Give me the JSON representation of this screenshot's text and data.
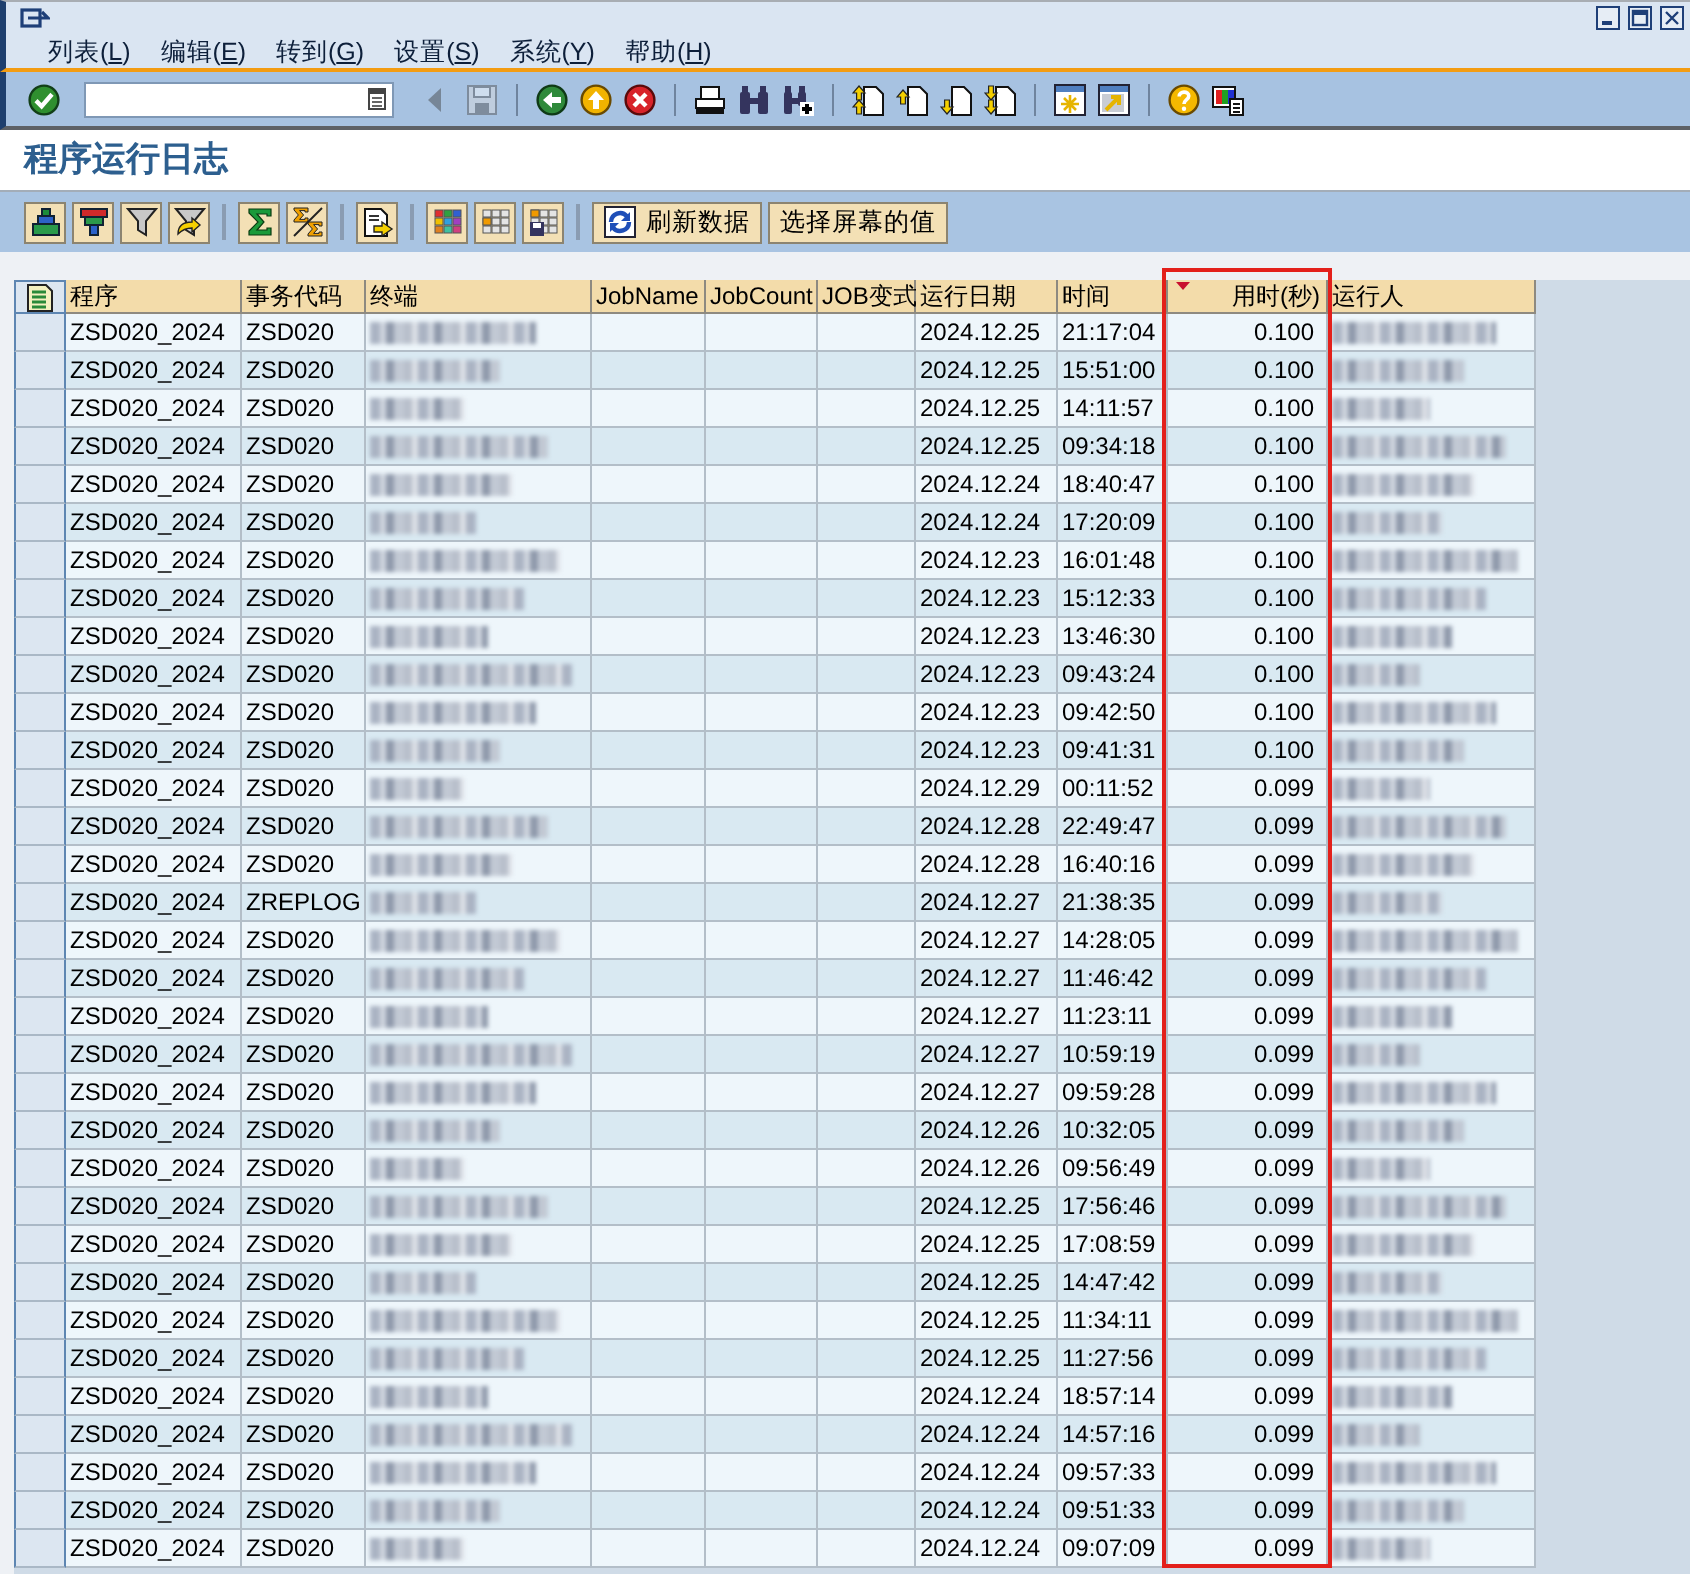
{
  "menu": [
    {
      "prefix": "列表(",
      "accel": "L",
      "suffix": ")"
    },
    {
      "prefix": "编辑(",
      "accel": "E",
      "suffix": ")"
    },
    {
      "prefix": "转到(",
      "accel": "G",
      "suffix": ")"
    },
    {
      "prefix": "设置(",
      "accel": "S",
      "suffix": ")"
    },
    {
      "prefix": "系统(",
      "accel": "Y",
      "suffix": ")"
    },
    {
      "prefix": "帮助(",
      "accel": "H",
      "suffix": ")"
    }
  ],
  "system_toolbar": [
    {
      "kind": "button",
      "disabled": false
    },
    {
      "kind": "field"
    },
    {
      "kind": "button",
      "disabled": true
    },
    {
      "kind": "button",
      "disabled": true
    },
    {
      "kind": "separator"
    },
    {
      "kind": "button",
      "disabled": false
    },
    {
      "kind": "button",
      "disabled": false
    },
    {
      "kind": "button",
      "disabled": false
    },
    {
      "kind": "separator"
    },
    {
      "kind": "button",
      "disabled": false
    },
    {
      "kind": "button",
      "disabled": false
    },
    {
      "kind": "button",
      "disabled": false
    },
    {
      "kind": "separator"
    },
    {
      "kind": "button",
      "disabled": false
    },
    {
      "kind": "button",
      "disabled": false
    },
    {
      "kind": "button",
      "disabled": false
    },
    {
      "kind": "button",
      "disabled": false
    },
    {
      "kind": "separator"
    },
    {
      "kind": "button",
      "disabled": false
    },
    {
      "kind": "button",
      "disabled": false
    },
    {
      "kind": "separator"
    },
    {
      "kind": "button",
      "disabled": false
    },
    {
      "kind": "button",
      "disabled": false
    }
  ],
  "screen_title": "程序运行日志",
  "app_toolbar": [
    {
      "kind": "button"
    },
    {
      "kind": "button"
    },
    {
      "kind": "button"
    },
    {
      "kind": "button"
    },
    {
      "kind": "separator"
    },
    {
      "kind": "button"
    },
    {
      "kind": "button"
    },
    {
      "kind": "separator"
    },
    {
      "kind": "button"
    },
    {
      "kind": "separator"
    },
    {
      "kind": "button"
    },
    {
      "kind": "button"
    },
    {
      "kind": "button"
    },
    {
      "kind": "separator"
    },
    {
      "kind": "labeled_button",
      "label": "刷新数据",
      "has_icon": true
    },
    {
      "kind": "labeled_button",
      "label": "选择屏幕的值"
    }
  ],
  "table": {
    "columns": [
      {
        "label": "程序",
        "kind": "text",
        "sorted": false,
        "highlighted": false
      },
      {
        "label": "事务代码",
        "kind": "text",
        "sorted": false,
        "highlighted": false
      },
      {
        "label": "终端",
        "kind": "blurred",
        "sorted": false,
        "highlighted": false
      },
      {
        "label": "JobName",
        "kind": "text",
        "sorted": false,
        "highlighted": false
      },
      {
        "label": "JobCount",
        "kind": "text",
        "sorted": false,
        "highlighted": false
      },
      {
        "label": "JOB变式",
        "kind": "text",
        "sorted": false,
        "highlighted": false
      },
      {
        "label": "运行日期",
        "kind": "text",
        "sorted": false,
        "highlighted": false
      },
      {
        "label": "时间",
        "kind": "text",
        "sorted": false,
        "highlighted": false
      },
      {
        "label": "用时(秒)",
        "kind": "number",
        "sorted": true,
        "highlighted": true
      },
      {
        "label": "运行人",
        "kind": "blurred",
        "sorted": false,
        "highlighted": false
      }
    ],
    "rows": [
      {
        "selected": false,
        "cells": [
          "ZSD020_2024",
          "ZSD020",
          null,
          null,
          null,
          null,
          "2024.12.25",
          "21:17:04",
          "0.100",
          null
        ]
      },
      {
        "selected": false,
        "cells": [
          "ZSD020_2024",
          "ZSD020",
          null,
          null,
          null,
          null,
          "2024.12.25",
          "15:51:00",
          "0.100",
          null
        ]
      },
      {
        "selected": false,
        "cells": [
          "ZSD020_2024",
          "ZSD020",
          null,
          null,
          null,
          null,
          "2024.12.25",
          "14:11:57",
          "0.100",
          null
        ]
      },
      {
        "selected": false,
        "cells": [
          "ZSD020_2024",
          "ZSD020",
          null,
          null,
          null,
          null,
          "2024.12.25",
          "09:34:18",
          "0.100",
          null
        ]
      },
      {
        "selected": false,
        "cells": [
          "ZSD020_2024",
          "ZSD020",
          null,
          null,
          null,
          null,
          "2024.12.24",
          "18:40:47",
          "0.100",
          null
        ]
      },
      {
        "selected": false,
        "cells": [
          "ZSD020_2024",
          "ZSD020",
          null,
          null,
          null,
          null,
          "2024.12.24",
          "17:20:09",
          "0.100",
          null
        ]
      },
      {
        "selected": false,
        "cells": [
          "ZSD020_2024",
          "ZSD020",
          null,
          null,
          null,
          null,
          "2024.12.23",
          "16:01:48",
          "0.100",
          null
        ]
      },
      {
        "selected": false,
        "cells": [
          "ZSD020_2024",
          "ZSD020",
          null,
          null,
          null,
          null,
          "2024.12.23",
          "15:12:33",
          "0.100",
          null
        ]
      },
      {
        "selected": false,
        "cells": [
          "ZSD020_2024",
          "ZSD020",
          null,
          null,
          null,
          null,
          "2024.12.23",
          "13:46:30",
          "0.100",
          null
        ]
      },
      {
        "selected": false,
        "cells": [
          "ZSD020_2024",
          "ZSD020",
          null,
          null,
          null,
          null,
          "2024.12.23",
          "09:43:24",
          "0.100",
          null
        ]
      },
      {
        "selected": false,
        "cells": [
          "ZSD020_2024",
          "ZSD020",
          null,
          null,
          null,
          null,
          "2024.12.23",
          "09:42:50",
          "0.100",
          null
        ]
      },
      {
        "selected": false,
        "cells": [
          "ZSD020_2024",
          "ZSD020",
          null,
          null,
          null,
          null,
          "2024.12.23",
          "09:41:31",
          "0.100",
          null
        ]
      },
      {
        "selected": false,
        "cells": [
          "ZSD020_2024",
          "ZSD020",
          null,
          null,
          null,
          null,
          "2024.12.29",
          "00:11:52",
          "0.099",
          null
        ]
      },
      {
        "selected": false,
        "cells": [
          "ZSD020_2024",
          "ZSD020",
          null,
          null,
          null,
          null,
          "2024.12.28",
          "22:49:47",
          "0.099",
          null
        ]
      },
      {
        "selected": false,
        "cells": [
          "ZSD020_2024",
          "ZSD020",
          null,
          null,
          null,
          null,
          "2024.12.28",
          "16:40:16",
          "0.099",
          null
        ]
      },
      {
        "selected": false,
        "cells": [
          "ZSD020_2024",
          "ZREPLOG",
          null,
          null,
          null,
          null,
          "2024.12.27",
          "21:38:35",
          "0.099",
          null
        ]
      },
      {
        "selected": false,
        "cells": [
          "ZSD020_2024",
          "ZSD020",
          null,
          null,
          null,
          null,
          "2024.12.27",
          "14:28:05",
          "0.099",
          null
        ]
      },
      {
        "selected": false,
        "cells": [
          "ZSD020_2024",
          "ZSD020",
          null,
          null,
          null,
          null,
          "2024.12.27",
          "11:46:42",
          "0.099",
          null
        ]
      },
      {
        "selected": false,
        "cells": [
          "ZSD020_2024",
          "ZSD020",
          null,
          null,
          null,
          null,
          "2024.12.27",
          "11:23:11",
          "0.099",
          null
        ]
      },
      {
        "selected": false,
        "cells": [
          "ZSD020_2024",
          "ZSD020",
          null,
          null,
          null,
          null,
          "2024.12.27",
          "10:59:19",
          "0.099",
          null
        ]
      },
      {
        "selected": false,
        "cells": [
          "ZSD020_2024",
          "ZSD020",
          null,
          null,
          null,
          null,
          "2024.12.27",
          "09:59:28",
          "0.099",
          null
        ]
      },
      {
        "selected": false,
        "cells": [
          "ZSD020_2024",
          "ZSD020",
          null,
          null,
          null,
          null,
          "2024.12.26",
          "10:32:05",
          "0.099",
          null
        ]
      },
      {
        "selected": false,
        "cells": [
          "ZSD020_2024",
          "ZSD020",
          null,
          null,
          null,
          null,
          "2024.12.26",
          "09:56:49",
          "0.099",
          null
        ]
      },
      {
        "selected": false,
        "cells": [
          "ZSD020_2024",
          "ZSD020",
          null,
          null,
          null,
          null,
          "2024.12.25",
          "17:56:46",
          "0.099",
          null
        ]
      },
      {
        "selected": false,
        "cells": [
          "ZSD020_2024",
          "ZSD020",
          null,
          null,
          null,
          null,
          "2024.12.25",
          "17:08:59",
          "0.099",
          null
        ]
      },
      {
        "selected": false,
        "cells": [
          "ZSD020_2024",
          "ZSD020",
          null,
          null,
          null,
          null,
          "2024.12.25",
          "14:47:42",
          "0.099",
          null
        ]
      },
      {
        "selected": false,
        "cells": [
          "ZSD020_2024",
          "ZSD020",
          null,
          null,
          null,
          null,
          "2024.12.25",
          "11:34:11",
          "0.099",
          null
        ]
      },
      {
        "selected": false,
        "cells": [
          "ZSD020_2024",
          "ZSD020",
          null,
          null,
          null,
          null,
          "2024.12.25",
          "11:27:56",
          "0.099",
          null
        ]
      },
      {
        "selected": false,
        "cells": [
          "ZSD020_2024",
          "ZSD020",
          null,
          null,
          null,
          null,
          "2024.12.24",
          "18:57:14",
          "0.099",
          null
        ]
      },
      {
        "selected": false,
        "cells": [
          "ZSD020_2024",
          "ZSD020",
          null,
          null,
          null,
          null,
          "2024.12.24",
          "14:57:16",
          "0.099",
          null
        ]
      },
      {
        "selected": false,
        "cells": [
          "ZSD020_2024",
          "ZSD020",
          null,
          null,
          null,
          null,
          "2024.12.24",
          "09:57:33",
          "0.099",
          null
        ]
      },
      {
        "selected": false,
        "cells": [
          "ZSD020_2024",
          "ZSD020",
          null,
          null,
          null,
          null,
          "2024.12.24",
          "09:51:33",
          "0.099",
          null
        ]
      },
      {
        "selected": false,
        "cells": [
          "ZSD020_2024",
          "ZSD020",
          null,
          null,
          null,
          null,
          "2024.12.24",
          "09:07:09",
          "0.099",
          null
        ]
      }
    ]
  }
}
